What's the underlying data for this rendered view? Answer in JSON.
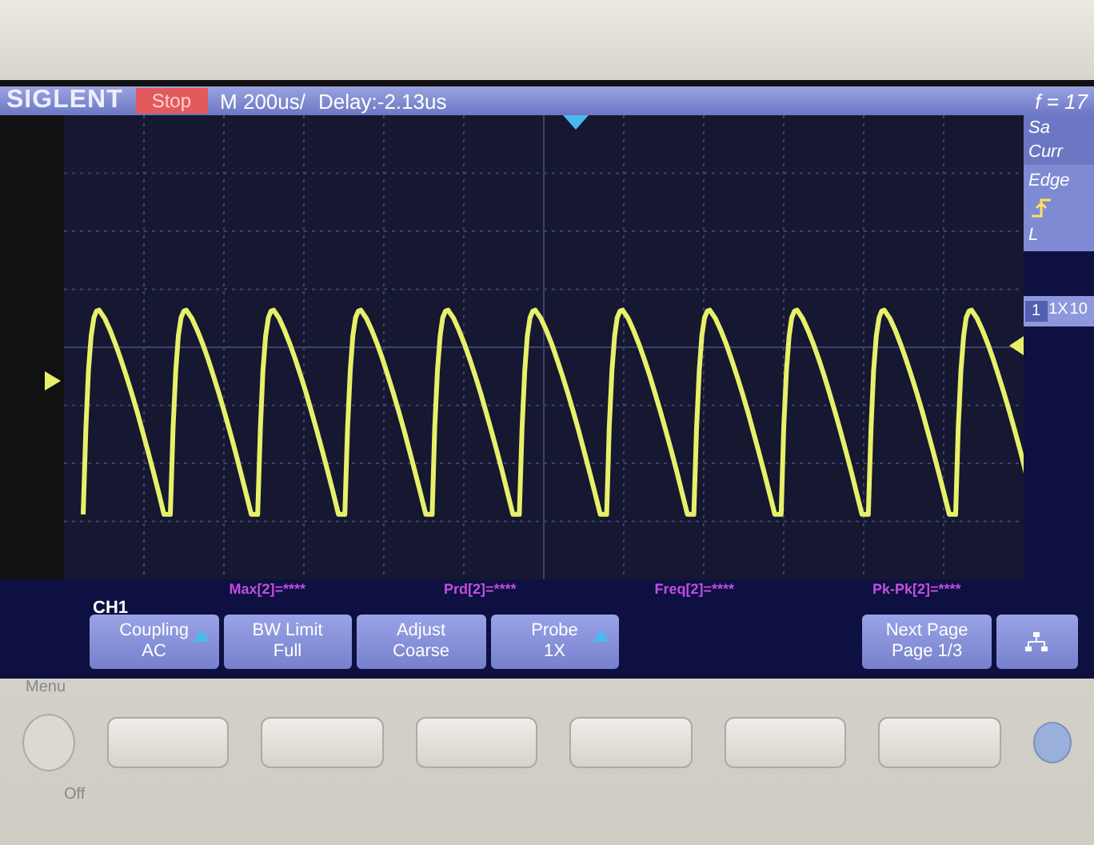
{
  "status_bar": {
    "brand": "SIGLENT",
    "run_state": "Stop",
    "timebase": "M 200us/",
    "delay": "Delay:-2.13us",
    "frequency": "f = 17"
  },
  "side_panel": {
    "labels": [
      "Sa",
      "Curr"
    ],
    "trigger_type": "Edge",
    "trigger_level_label": "L",
    "channel_number": "1",
    "channel_probe": "1X",
    "next_probe": "10"
  },
  "measurements": [
    {
      "label": "Max[2]=****"
    },
    {
      "label": "Prd[2]=****"
    },
    {
      "label": "Freq[2]=****"
    },
    {
      "label": "Pk-Pk[2]=****"
    }
  ],
  "channel_label": "CH1",
  "softkeys": [
    {
      "kind": "menu",
      "title": "Coupling",
      "value": "AC",
      "arrow": true
    },
    {
      "kind": "menu",
      "title": "BW Limit",
      "value": "Full",
      "arrow": false
    },
    {
      "kind": "menu",
      "title": "Adjust",
      "value": "Coarse",
      "arrow": false
    },
    {
      "kind": "menu",
      "title": "Probe",
      "value": "1X",
      "arrow": true
    },
    {
      "kind": "blank"
    },
    {
      "kind": "menu",
      "title": "Next Page",
      "value": "Page 1/3",
      "arrow": false
    },
    {
      "kind": "icon"
    }
  ],
  "bezel": {
    "menu_label": "Menu",
    "power_label": "Off"
  }
}
